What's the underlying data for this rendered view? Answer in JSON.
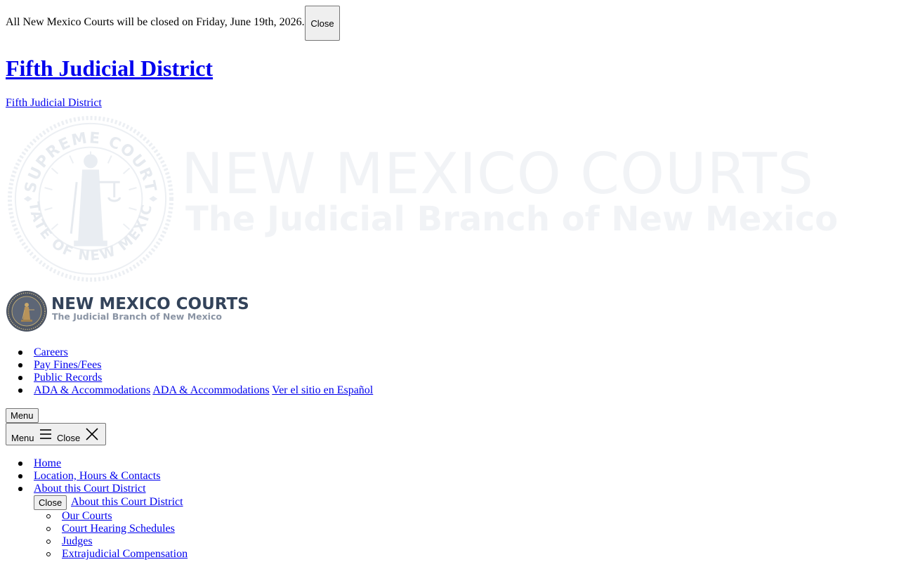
{
  "alert": {
    "message": "All New Mexico Courts will be closed on Friday, June 19th, 2026.",
    "close_label": "Close"
  },
  "site": {
    "title": "Fifth Judicial District",
    "subtitle": "Fifth Judicial District"
  },
  "banner": {
    "title": "NEW MEXICO COURTS",
    "subtitle": "The Judicial Branch of New Mexico",
    "seal_top_text": "SUPREME COURT",
    "seal_bottom_text": "STATE OF NEW MEXICO"
  },
  "logo": {
    "title": "NEW MEXICO COURTS",
    "subtitle": "The Judicial Branch of New Mexico"
  },
  "utility_nav": {
    "items": [
      {
        "label": "Careers"
      },
      {
        "label": "Pay Fines/Fees"
      },
      {
        "label": "Public Records"
      },
      {
        "label": "ADA & Accommodations"
      }
    ],
    "ada_duplicate": "ADA & Accommodations",
    "spanish": "Ver el sitio en Español"
  },
  "menu": {
    "button_label": "Menu",
    "toggle_menu_label": "Menu",
    "toggle_close_label": "Close"
  },
  "main_nav": {
    "items": [
      {
        "label": "Home"
      },
      {
        "label": "Location, Hours & Contacts"
      },
      {
        "label": "About this Court District"
      }
    ]
  },
  "submenu": {
    "close_label": "Close",
    "heading": "About this Court District",
    "items": [
      {
        "label": "Our Courts"
      },
      {
        "label": "Court Hearing Schedules"
      },
      {
        "label": "Judges"
      },
      {
        "label": "Extrajudicial Compensation"
      }
    ]
  },
  "colors": {
    "link": "#0000ee",
    "logo_title": "#33435a",
    "logo_subtitle": "#8a94a4",
    "banner_faint": "#f1f3f6"
  }
}
